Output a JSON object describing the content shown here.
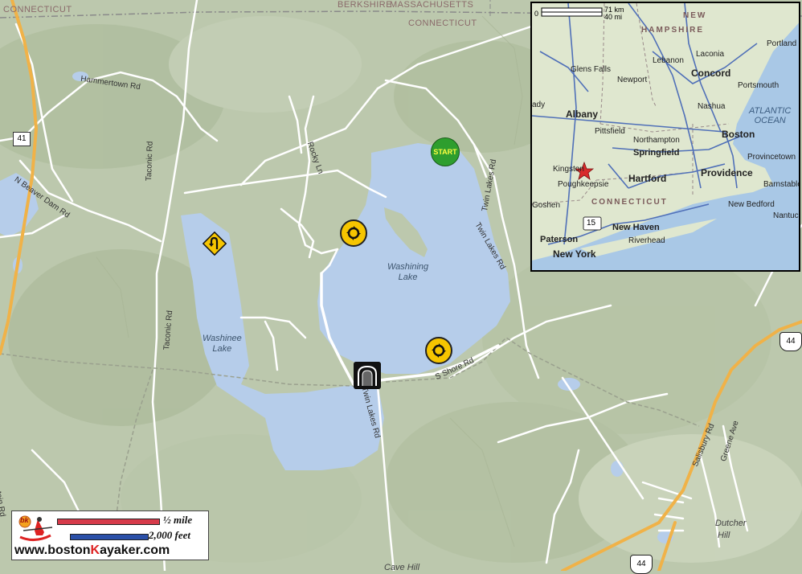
{
  "map": {
    "state_labels": [
      "CONNECTICUT",
      "BERKSHIRE",
      "MASSACHUSETTS",
      "CONNECTICUT"
    ],
    "road_labels": [
      "Hammertown Rd",
      "N Beaver Dam Rd",
      "Taconic Rd",
      "Rocky Ln",
      "Twin Lakes Rd",
      "Twin Lakes Rd",
      "Taconic Rd",
      "S Shore Rd",
      "Twin Lakes Rd",
      "Salisbury Rd",
      "Greene Ave",
      "ntain Rd"
    ],
    "lakes": [
      {
        "name": "Washining",
        "name2": "Lake"
      },
      {
        "name": "Washinee",
        "name2": "Lake"
      }
    ],
    "places": [
      "Dutcher",
      "Hill",
      "Cave Hill"
    ],
    "shields": {
      "route41": "41",
      "us44_top": "44",
      "us44_bottom": "44"
    },
    "start_label": "START",
    "icons": [
      "roundabout-icon",
      "roundabout-icon",
      "u-turn-icon",
      "tunnel-icon",
      "start-icon"
    ],
    "colors": {
      "water": "#b6cdea",
      "land": "#bcc8ad",
      "road": "#ffffff",
      "highway": "#f0b248",
      "start": "#2e9e2e",
      "sign": "#f6c500"
    }
  },
  "inset": {
    "scale_km": "71 km",
    "scale_mi": "40 mi",
    "scale_zero": "0",
    "states": [
      "NEW",
      "HAMPSHIRE",
      "CONNECTICUT"
    ],
    "ocean": [
      "ATLANTIC",
      "OCEAN"
    ],
    "cities_bold": [
      "Albany",
      "Concord",
      "Boston",
      "Springfield",
      "Hartford",
      "Providence",
      "New Haven",
      "Paterson",
      "New York"
    ],
    "cities": [
      "Portland",
      "Laconia",
      "Glens Falls",
      "Lebanon",
      "Newport",
      "Portsmouth",
      "Nashua",
      "Pittsfield",
      "Northampton",
      "Provincetown",
      "Kingston",
      "Poughkeepsie",
      "Barnstable",
      "Goshen",
      "New Bedford",
      "Nantuc",
      "Riverhead",
      "ady"
    ],
    "route_shield": "15",
    "marker": "star-marker-icon"
  },
  "legend": {
    "half_mile": "½ mile",
    "feet": "2,000 feet",
    "url_prefix": "www.boston",
    "url_k": "K",
    "url_suffix": "ayaker.com",
    "logo": "bk",
    "colors": {
      "mile_bar": "#d63a4a",
      "feet_bar": "#2a4fa8",
      "brand_red": "#d22"
    }
  }
}
